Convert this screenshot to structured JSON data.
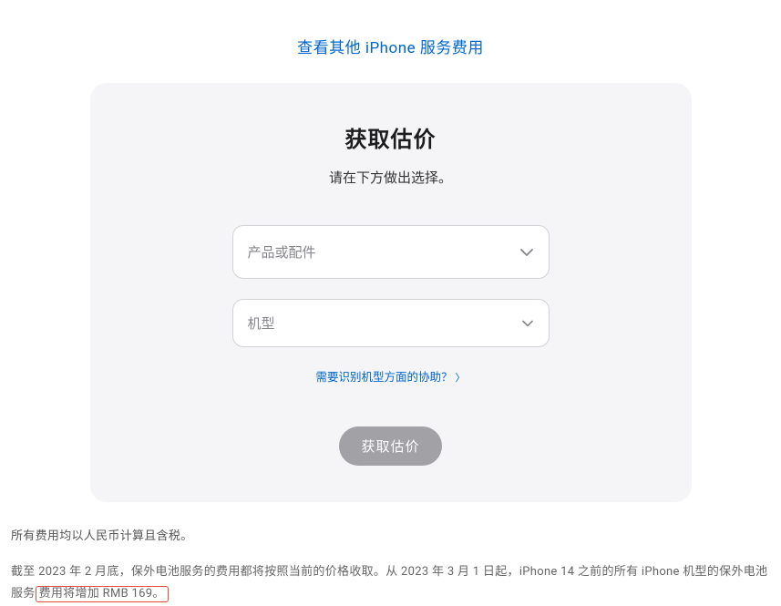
{
  "topLink": {
    "text": "查看其他 iPhone 服务费用"
  },
  "card": {
    "title": "获取估价",
    "subtitle": "请在下方做出选择。",
    "select1": {
      "placeholder": "产品或配件"
    },
    "select2": {
      "placeholder": "机型"
    },
    "helpLink": {
      "text": "需要识别机型方面的协助？"
    },
    "submit": {
      "label": "获取估价"
    }
  },
  "footnotes": {
    "line1": "所有费用均以人民币计算且含税。",
    "line2_a": "截至 2023 年 2 月底，保外电池服务的费用都将按照当前的价格收取。从 2023 年 3 月 1 日起，iPhone 14 之前的所有 iPhone 机型的保外电池服务",
    "line2_b": "费用将增加 RMB 169。"
  }
}
